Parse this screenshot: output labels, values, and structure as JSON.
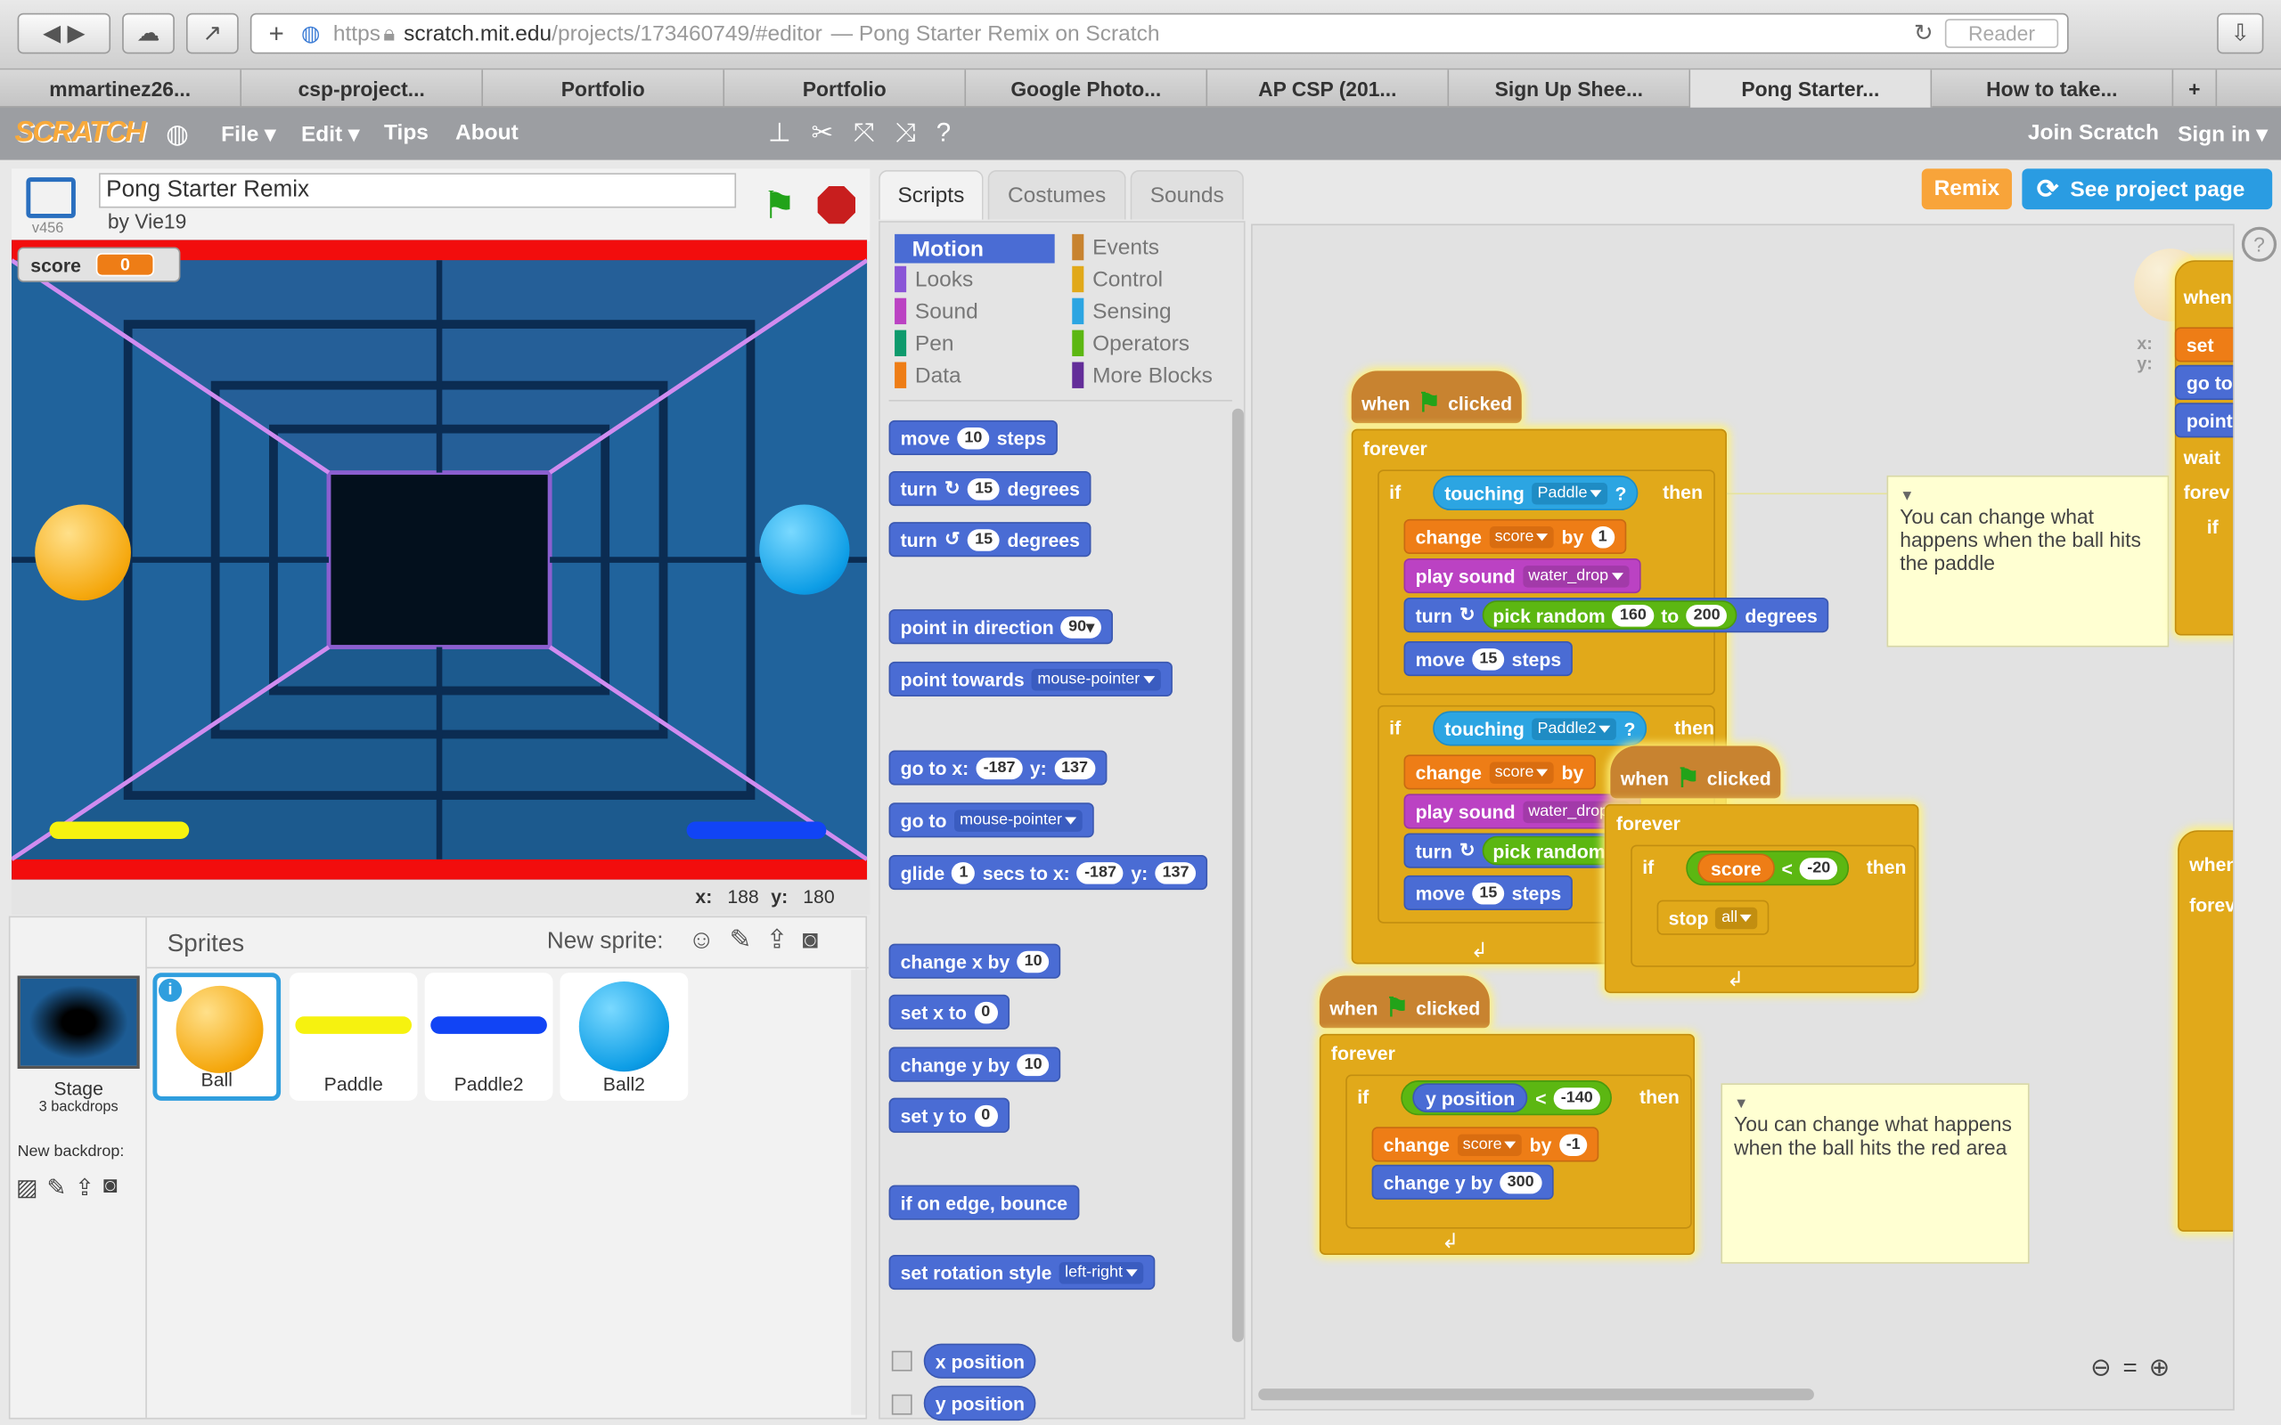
{
  "browser": {
    "url_scheme": "https",
    "url_host": "scratch.mit.edu",
    "url_path": "/projects/173460749/#editor",
    "url_title": "— Pong Starter Remix on Scratch",
    "reader": "Reader"
  },
  "bookmarks": [
    "mmartinez26...",
    "csp-project...",
    "Portfolio",
    "Portfolio",
    "Google Photo...",
    "AP CSP (201...",
    "Sign Up Shee...",
    "Pong Starter...",
    "How to take..."
  ],
  "menu": {
    "logo": "SCRATCH",
    "file": "File",
    "edit": "Edit",
    "tips": "Tips",
    "about": "About",
    "join": "Join Scratch",
    "signin": "Sign in"
  },
  "project": {
    "title": "Pong Starter Remix",
    "author": "by Vie19",
    "version": "v456",
    "remix": "Remix",
    "see_page": "See project page"
  },
  "stage": {
    "var_name": "score",
    "var_value": "0",
    "x_label": "x:",
    "x": "188",
    "y_label": "y:",
    "y": "180"
  },
  "tabs": {
    "scripts": "Scripts",
    "costumes": "Costumes",
    "sounds": "Sounds"
  },
  "categories": {
    "motion": "Motion",
    "looks": "Looks",
    "sound": "Sound",
    "pen": "Pen",
    "data": "Data",
    "events": "Events",
    "control": "Control",
    "sensing": "Sensing",
    "operators": "Operators",
    "more": "More Blocks"
  },
  "palette": {
    "move": "move",
    "steps": "steps",
    "ten": "10",
    "turn": "turn",
    "degrees": "degrees",
    "fifteen": "15",
    "point_in_direction": "point in direction",
    "ninety": "90",
    "point_towards": "point towards",
    "mouse_pointer": "mouse-pointer",
    "go_to_x": "go to x:",
    "gx": "-187",
    "y_lbl": "y:",
    "gy": "137",
    "go_to": "go to",
    "glide": "glide",
    "one": "1",
    "secs_to_x": "secs to x:",
    "change_x_by": "change x by",
    "set_x_to": "set x to",
    "zero": "0",
    "change_y_by": "change y by",
    "set_y_to": "set y to",
    "bounce": "if on edge, bounce",
    "rotation": "set rotation style",
    "left_right": "left-right",
    "x_position": "x position",
    "y_position": "y position"
  },
  "sprites": {
    "header": "Sprites",
    "new_sprite": "New sprite:",
    "stage": "Stage",
    "backdrops": "3 backdrops",
    "new_backdrop": "New backdrop:",
    "items": [
      "Ball",
      "Paddle",
      "Paddle2",
      "Ball2"
    ]
  },
  "script1": {
    "when": "when",
    "clicked": "clicked",
    "forever": "forever",
    "if": "if",
    "then": "then",
    "touching": "touching",
    "paddle": "Paddle",
    "paddle2": "Paddle2",
    "q": "?",
    "change": "change",
    "score": "score",
    "by": "by",
    "one": "1",
    "play_sound": "play sound",
    "water_drop": "water_drop",
    "turn": "turn",
    "pick_random": "pick random",
    "from": "160",
    "to_lbl": "to",
    "to": "200",
    "degrees": "degrees",
    "move": "move",
    "fifteen": "15",
    "steps": "steps"
  },
  "script2": {
    "stop": "stop",
    "all": "all",
    "lt": "<",
    "minus20": "-20"
  },
  "script3": {
    "y_position": "y position",
    "lt": "<",
    "minus140": "-140",
    "minus1": "-1",
    "change_y_by": "change y by",
    "three_hundred": "300"
  },
  "notes": {
    "paddle": "You can change what happens when the ball hits the paddle",
    "red": "You can change what happens when the ball hits the red area"
  },
  "edge": {
    "when": "when",
    "set": "set",
    "goto": "go to",
    "point": "point",
    "wait": "wait",
    "forever": "forev",
    "if": "if",
    "x": "x:",
    "y": "y:"
  }
}
